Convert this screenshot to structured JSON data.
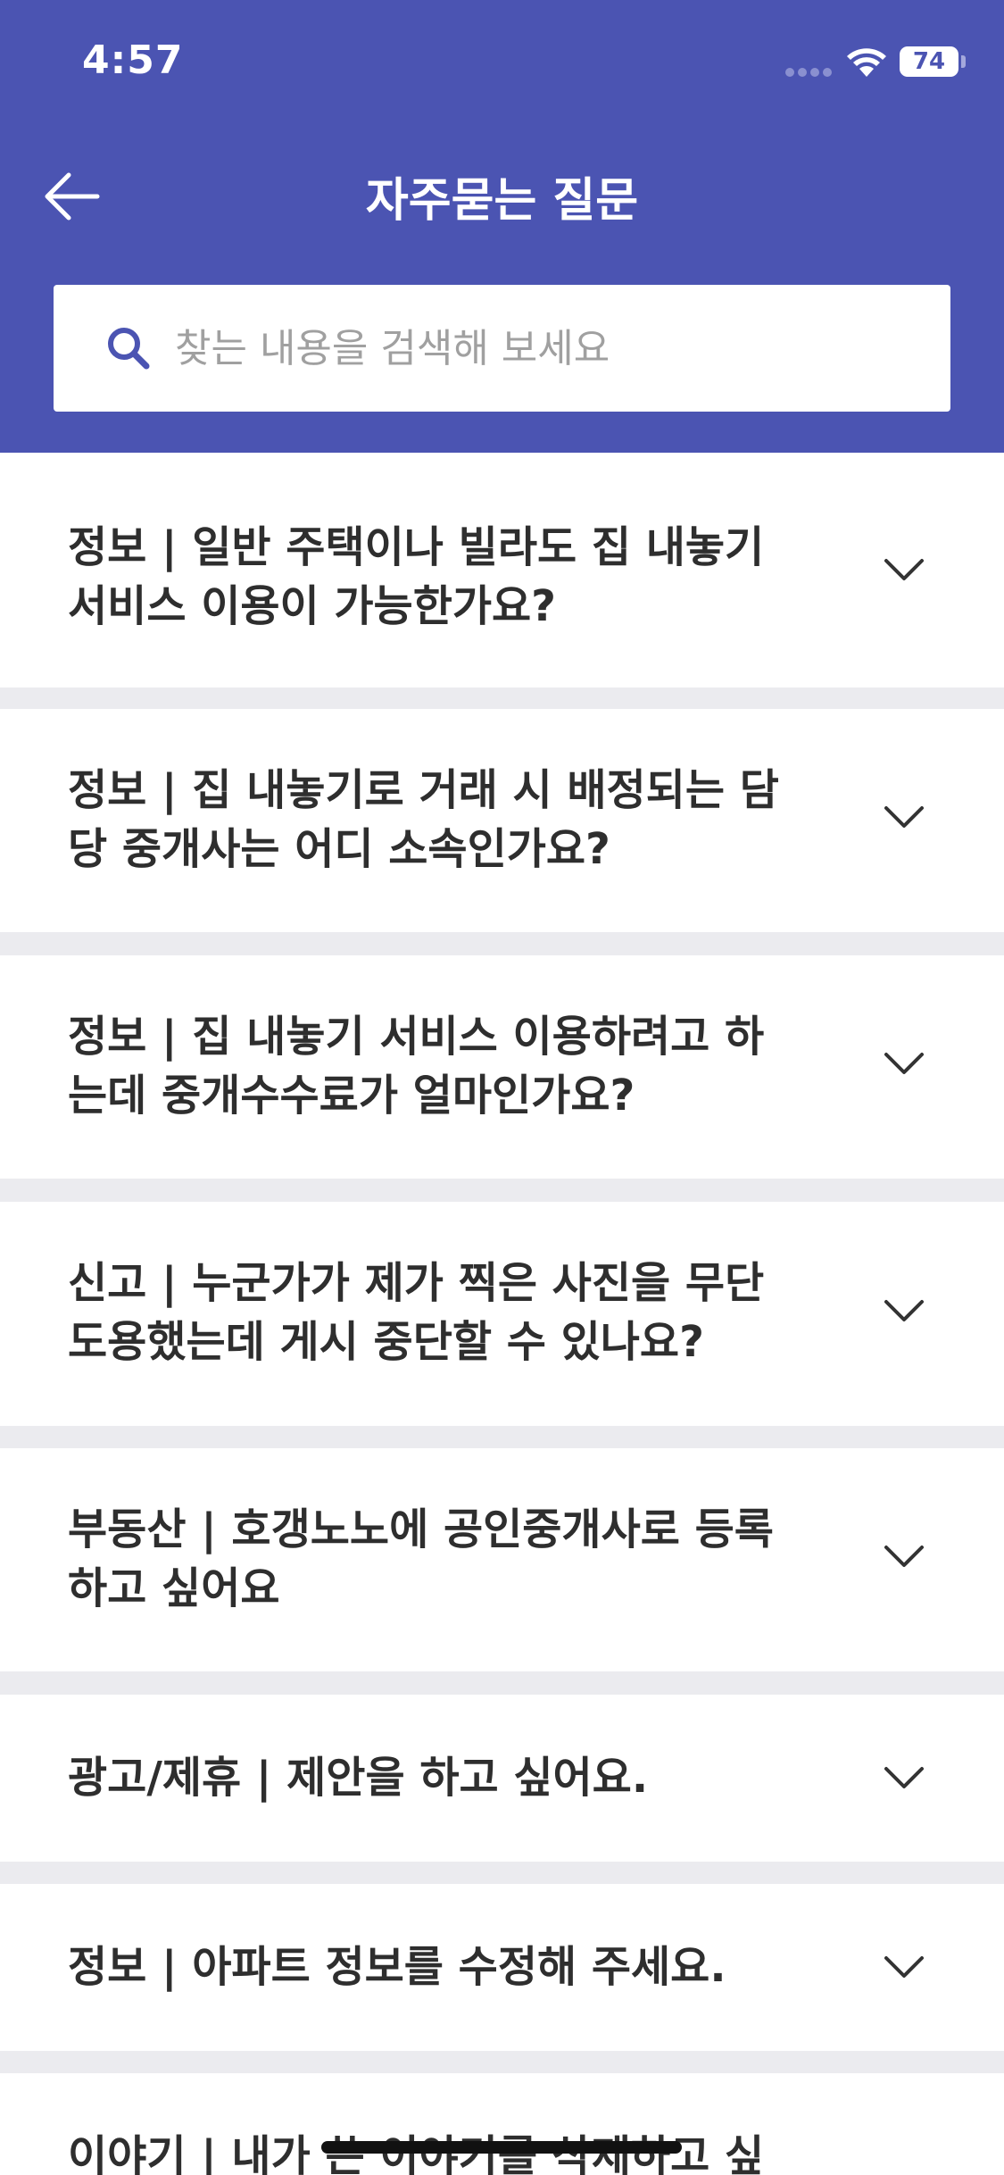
{
  "status_bar": {
    "time": "4:57",
    "battery": "74"
  },
  "header": {
    "title": "자주묻는 질문",
    "back_icon": "arrow-left-icon"
  },
  "search": {
    "placeholder": "찾는 내용을 검색해 보세요",
    "value": "",
    "icon": "search-icon"
  },
  "faq": [
    {
      "lines": [
        "정보 | 일반 주택이나 빌라도 집 내놓기",
        "서비스 이용이 가능한가요?"
      ]
    },
    {
      "lines": [
        "정보 | 집 내놓기로 거래 시 배정되는 담",
        "당 중개사는 어디 소속인가요?"
      ]
    },
    {
      "lines": [
        "정보 | 집 내놓기 서비스 이용하려고 하",
        "는데 중개수수료가 얼마인가요?"
      ]
    },
    {
      "lines": [
        "신고 | 누군가가 제가 찍은 사진을 무단",
        "도용했는데 게시 중단할 수 있나요?"
      ]
    },
    {
      "lines": [
        "부동산 | 호갱노노에 공인중개사로 등록",
        "하고 싶어요"
      ]
    },
    {
      "lines": [
        "광고/제휴 | 제안을 하고 싶어요."
      ]
    },
    {
      "lines": [
        "정보 | 아파트 정보를 수정해 주세요."
      ]
    },
    {
      "lines": [
        "이야기 | 내가 쓴 이야기를 삭제하고 싶"
      ]
    }
  ],
  "colors": {
    "header": "#4b54b2",
    "accent": "#4b54b2",
    "divider": "#ebebef"
  }
}
